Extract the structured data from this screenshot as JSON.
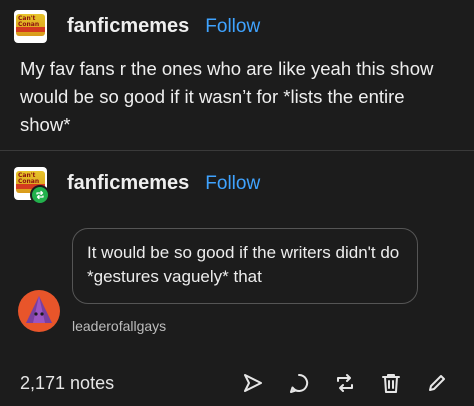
{
  "post": {
    "username": "fanficmemes",
    "follow_label": "Follow",
    "avatar_label": "Can't Believe It's Not Conan",
    "text": "My fav fans r the ones who are like yeah this show would be so good if it wasn’t for *lists the entire show*"
  },
  "reblog": {
    "username": "fanficmemes",
    "follow_label": "Follow"
  },
  "ask": {
    "text": "It would be so good if the writers didn't do *gestures vaguely* that",
    "asker": "leaderofallgays"
  },
  "footer": {
    "notes": "2,171 notes"
  },
  "colors": {
    "background": "#1c1c1c",
    "follow": "#3fa3ff",
    "reblog_badge": "#22b14c"
  },
  "icons": {
    "actions": [
      "share-icon",
      "reply-icon",
      "reblog-icon",
      "delete-icon",
      "edit-icon"
    ]
  }
}
